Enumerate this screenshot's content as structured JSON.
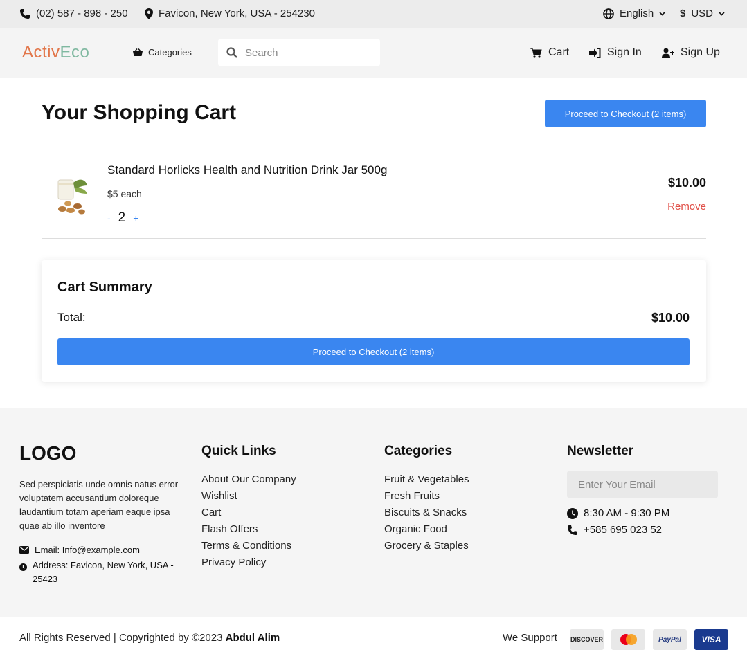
{
  "topbar": {
    "phone": "(02) 587 - 898 - 250",
    "address": "Favicon, New York, USA - 254230",
    "language": "English",
    "currency": "USD"
  },
  "header": {
    "logo": {
      "part1": "Activ",
      "part2": "Eco"
    },
    "categories_label": "Categories",
    "search_placeholder": "Search",
    "cart_label": "Cart",
    "signin_label": "Sign In",
    "signup_label": "Sign Up"
  },
  "main": {
    "title": "Your Shopping Cart",
    "checkout_label": "Proceed to Checkout (2 items)",
    "items": [
      {
        "name": "Standard Horlicks Health and Nutrition Drink Jar 500g",
        "unit_price": "$5 each",
        "quantity": "2",
        "minus": "-",
        "plus": "+",
        "line_total": "$10.00",
        "remove_label": "Remove"
      }
    ],
    "summary": {
      "title": "Cart Summary",
      "total_label": "Total:",
      "total_value": "$10.00",
      "checkout_label": "Proceed to Checkout (2 items)"
    }
  },
  "footer": {
    "logo": "LOGO",
    "description": "Sed perspiciatis unde omnis natus error voluptatem accusantium doloreque laudantium totam aperiam eaque ipsa quae ab illo inventore",
    "email": "Email: Info@example.com",
    "address": "Address: Favicon, New York, USA - 25423",
    "quick_links": {
      "title": "Quick Links",
      "links": [
        "About Our Company",
        "Wishlist",
        "Cart",
        "Flash Offers",
        "Terms & Conditions",
        "Privacy Policy"
      ]
    },
    "categories": {
      "title": "Categories",
      "links": [
        "Fruit & Vegetables",
        "Fresh Fruits",
        "Biscuits & Snacks",
        "Organic Food",
        "Grocery & Staples"
      ]
    },
    "newsletter": {
      "title": "Newsletter",
      "placeholder": "Enter Your Email",
      "hours": "8:30 AM - 9:30 PM",
      "phone": "+585 695 023 52"
    },
    "copyright": "All Rights Reserved | Copyrighted by ©2023",
    "author": "Abdul Alim",
    "we_support": "We Support",
    "payments": [
      "DISCOVER",
      "mastercard",
      "PayPal",
      "VISA"
    ]
  },
  "colors": {
    "accent": "#3a86f0",
    "remove": "#e04e46",
    "logo_orange": "#e2764a",
    "logo_teal": "#7fb8a0"
  }
}
